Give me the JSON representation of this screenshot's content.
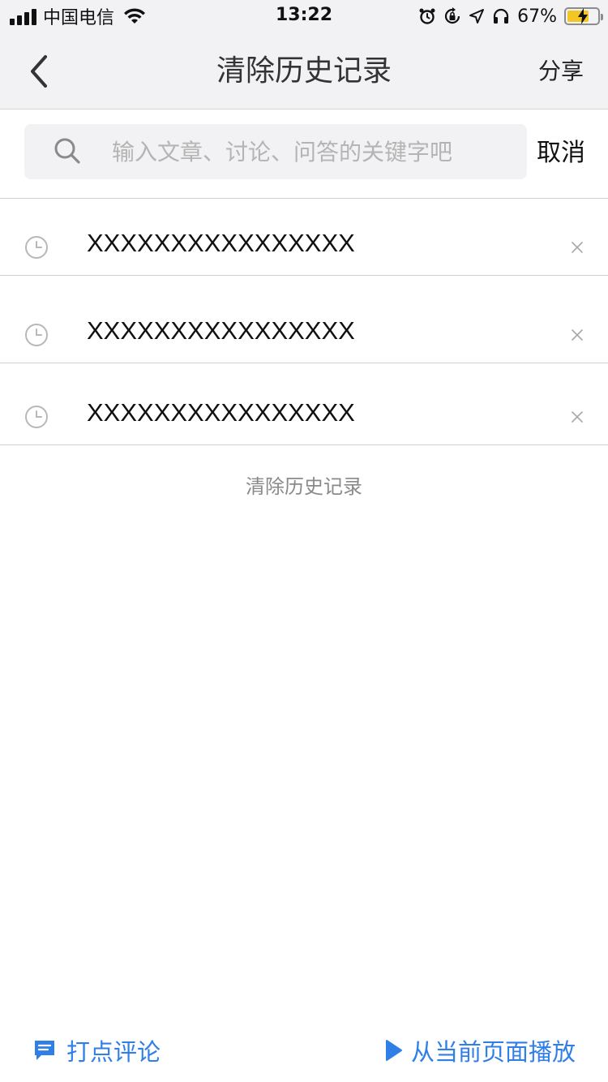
{
  "status_bar": {
    "carrier": "中国电信",
    "time": "13:22",
    "battery": "67%"
  },
  "nav": {
    "title": "清除历史记录",
    "share_label": "分享",
    "back_icon": "chevron-left-icon"
  },
  "search": {
    "placeholder": "输入文章、讨论、问答的关键字吧",
    "value": "",
    "cancel_label": "取消"
  },
  "history": {
    "items": [
      {
        "text": "XXXXXXXXXXXXXXXX"
      },
      {
        "text": "XXXXXXXXXXXXXXXX"
      },
      {
        "text": "XXXXXXXXXXXXXXXX"
      }
    ],
    "clear_label": "清除历史记录"
  },
  "bottom_bar": {
    "comment_label": "打点评论",
    "play_label": "从当前页面播放"
  },
  "colors": {
    "accent": "#2f7fe6",
    "bar_bg": "#f2f2f4",
    "battery_fill": "#f4c623"
  }
}
